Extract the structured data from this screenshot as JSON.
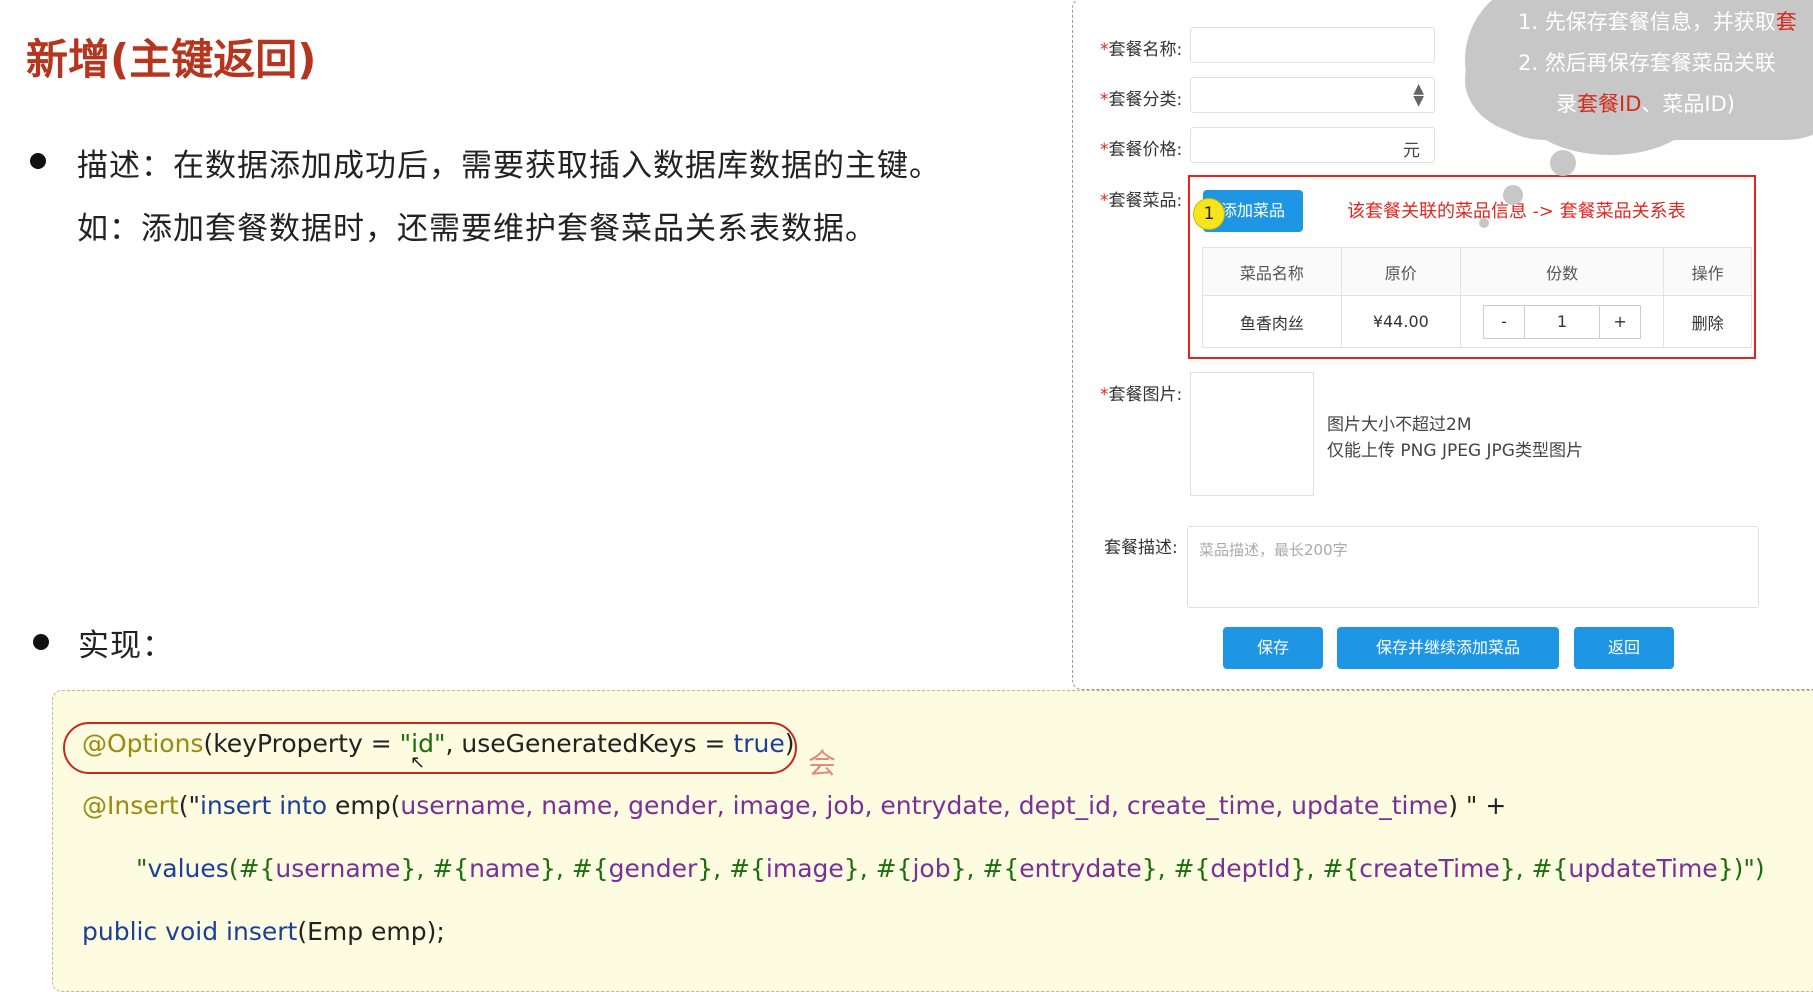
{
  "slide": {
    "title": "新增(主键返回)",
    "desc_line1": "描述：在数据添加成功后，需要获取插入数据库数据的主键。",
    "desc_line2": "如：添加套餐数据时，还需要维护套餐菜品关系表数据。",
    "impl_label": "实现："
  },
  "dialog": {
    "name_label": "套餐名称:",
    "category_label": "套餐分类:",
    "price_label": "套餐价格:",
    "price_unit": "元",
    "dishes_label": "套餐菜品:",
    "add_dish_button": "添加菜品",
    "step_badge": "1",
    "relation_note": "该套餐关联的菜品信息 -> 套餐菜品关系表",
    "table": {
      "headers": [
        "菜品名称",
        "原价",
        "份数",
        "操作"
      ],
      "rows": [
        {
          "name": "鱼香肉丝",
          "price": "¥44.00",
          "minus": "-",
          "qty": "1",
          "plus": "+",
          "action": "删除"
        }
      ]
    },
    "image_label": "套餐图片:",
    "image_hint1": "图片大小不超过2M",
    "image_hint2": "仅能上传 PNG JPEG JPG类型图片",
    "desc_label": "套餐描述:",
    "desc_placeholder": "菜品描述，最长200字",
    "buttons": {
      "save": "保存",
      "save_continue": "保存并继续添加菜品",
      "back": "返回"
    }
  },
  "callout": {
    "line1_num": "1.",
    "line1_text": "先保存套餐信息，并获取",
    "line1_red": "套",
    "line2_num": "2.",
    "line2_text": "然后再保存套餐菜品关联",
    "line3_pre": "录",
    "line3_red": "套餐ID",
    "line3_post": "、菜品ID)"
  },
  "code": {
    "l1_ann": "@Options",
    "l1_a": "(keyProperty = ",
    "l1_str": "\"id\"",
    "l1_b": ", useGeneratedKeys = ",
    "l1_kw": "true",
    "l1_c": ")",
    "l2_ann": "@Insert",
    "l2_a": "(\"",
    "l2_kw": "insert into",
    "l2_b": " emp(",
    "l2_fields": "username, name, gender, image, job, entrydate, dept_id, create_time, update_time",
    "l2_c": ") \" +",
    "l3_a": "\"",
    "l3_kw": "values",
    "l3_b": "(#{",
    "l3_fields": "username",
    "l3_c": "}, #{",
    "l3_f2": "name",
    "l3_d": "}, #{",
    "l3_f3": "gender",
    "l3_e": "}, #{",
    "l3_f4": "image",
    "l3_f": "}, #{",
    "l3_f5": "job",
    "l3_g": "}, #{",
    "l3_f6": "entrydate",
    "l3_h": "}, #{",
    "l3_f7": "deptId",
    "l3_i": "}, #{",
    "l3_f8": "createTime",
    "l3_j": "}, #{",
    "l3_f9": "updateTime",
    "l3_k": "})\")",
    "l4_kw": "public void",
    "l4_a": " insert",
    "l4_b": "(Emp emp);",
    "handwrite": "会"
  }
}
